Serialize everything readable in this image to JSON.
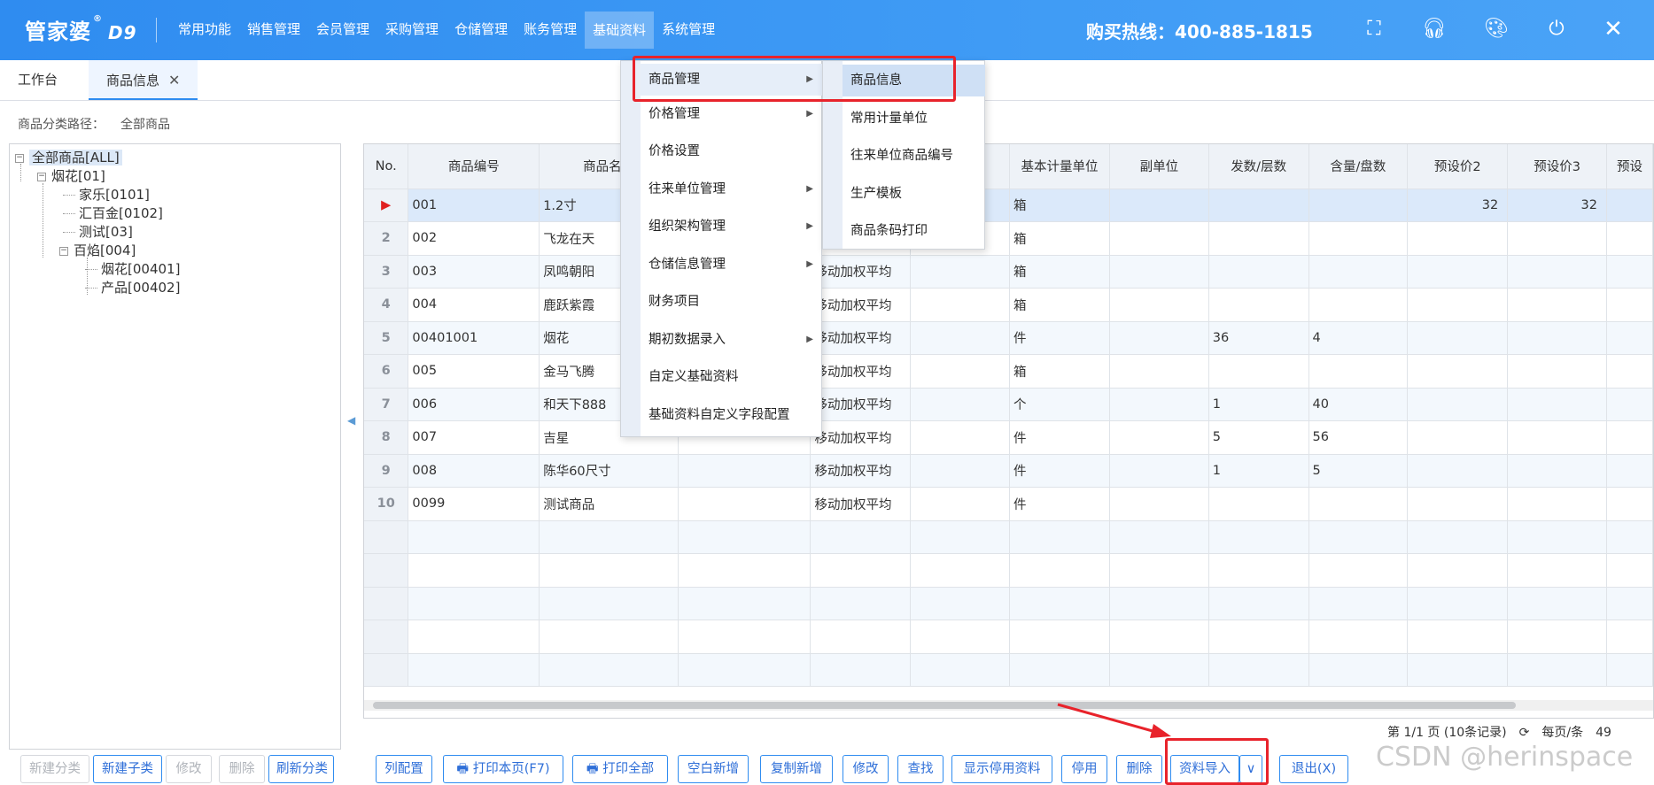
{
  "app": {
    "logo": "管家婆",
    "logo_sup": "®",
    "logo_version": "D9",
    "hotline": "购买热线：400-885-1815"
  },
  "nav": [
    "常用功能",
    "销售管理",
    "会员管理",
    "采购管理",
    "仓储管理",
    "账务管理",
    "基础资料",
    "系统管理"
  ],
  "top_icons": [
    "scan-icon",
    "headset-icon",
    "palette-icon",
    "power-icon",
    "close-icon"
  ],
  "tabs": [
    "工作台",
    "商品信息"
  ],
  "path": {
    "label": "商品分类路径：",
    "value": "全部商品"
  },
  "tree": [
    "全部商品[ALL]",
    "烟花[01]",
    "家乐[0101]",
    "汇百金[0102]",
    "测试[03]",
    "百焰[004]",
    "烟花[00401]",
    "产品[00402]"
  ],
  "columns": [
    "No.",
    "商品编号",
    "商品名称",
    "",
    "",
    "",
    "基本计量单位",
    "副单位",
    "发数/层数",
    "含量/盘数",
    "预设价2",
    "预设价3",
    "预设"
  ],
  "rows": [
    {
      "no": "",
      "code": "001",
      "name": "1.2寸",
      "c3": "",
      "method": "",
      "c5": "",
      "unit": "箱",
      "sub": "",
      "layers": "",
      "qty": "",
      "p2": "32",
      "p3": "32"
    },
    {
      "no": "2",
      "code": "002",
      "name": "飞龙在天",
      "c3": "",
      "method": "",
      "c5": "",
      "unit": "箱",
      "sub": "",
      "layers": "",
      "qty": "",
      "p2": "",
      "p3": ""
    },
    {
      "no": "3",
      "code": "003",
      "name": "凤鸣朝阳",
      "c3": "",
      "method": "移动加权平均",
      "c5": "",
      "unit": "箱",
      "sub": "",
      "layers": "",
      "qty": "",
      "p2": "",
      "p3": ""
    },
    {
      "no": "4",
      "code": "004",
      "name": "鹿跃紫霞",
      "c3": "",
      "method": "移动加权平均",
      "c5": "",
      "unit": "箱",
      "sub": "",
      "layers": "",
      "qty": "",
      "p2": "",
      "p3": ""
    },
    {
      "no": "5",
      "code": "00401001",
      "name": "烟花",
      "c3": "",
      "method": "移动加权平均",
      "c5": "",
      "unit": "件",
      "sub": "",
      "layers": "36",
      "qty": "4",
      "p2": "",
      "p3": ""
    },
    {
      "no": "6",
      "code": "005",
      "name": "金马飞腾",
      "c3": "",
      "method": "移动加权平均",
      "c5": "",
      "unit": "箱",
      "sub": "",
      "layers": "",
      "qty": "",
      "p2": "",
      "p3": ""
    },
    {
      "no": "7",
      "code": "006",
      "name": "和天下888",
      "c3": "",
      "method": "移动加权平均",
      "c5": "",
      "unit": "个",
      "sub": "",
      "layers": "1",
      "qty": "40",
      "p2": "",
      "p3": ""
    },
    {
      "no": "8",
      "code": "007",
      "name": "吉星",
      "c3": "",
      "method": "移动加权平均",
      "c5": "",
      "unit": "件",
      "sub": "",
      "layers": "5",
      "qty": "56",
      "p2": "",
      "p3": ""
    },
    {
      "no": "9",
      "code": "008",
      "name": "陈华60尺寸",
      "c3": "",
      "method": "移动加权平均",
      "c5": "",
      "unit": "件",
      "sub": "",
      "layers": "1",
      "qty": "5",
      "p2": "",
      "p3": ""
    },
    {
      "no": "10",
      "code": "0099",
      "name": "测试商品",
      "c3": "",
      "method": "移动加权平均",
      "c5": "",
      "unit": "件",
      "sub": "",
      "layers": "",
      "qty": "",
      "p2": "",
      "p3": ""
    }
  ],
  "pager": {
    "info": "第 1/1 页 (10条记录)",
    "per_page_label": "每页/条",
    "per_page": "49"
  },
  "tree_buttons": [
    "新建分类",
    "新建子类",
    "修改",
    "删除",
    "刷新分类"
  ],
  "buttons": [
    "列配置",
    "打印本页(F7)",
    "打印全部",
    "空白新增",
    "复制新增",
    "修改",
    "查找",
    "显示停用资料",
    "停用",
    "删除",
    "资料导入",
    "退出(X)"
  ],
  "menu": {
    "items": [
      "商品管理",
      "价格管理",
      "价格设置",
      "往来单位管理",
      "组织架构管理",
      "仓储信息管理",
      "财务项目",
      "期初数据录入",
      "自定义基础资料",
      "基础资料自定义字段配置"
    ],
    "submenu": [
      "商品信息",
      "常用计量单位",
      "往来单位商品编号",
      "生产模板",
      "商品条码打印"
    ]
  },
  "watermark": "CSDN @herinspace",
  "colors": {
    "header": "#2f8cf0",
    "highlight_box": "#e8232b",
    "button_text": "#2f6fd8"
  }
}
